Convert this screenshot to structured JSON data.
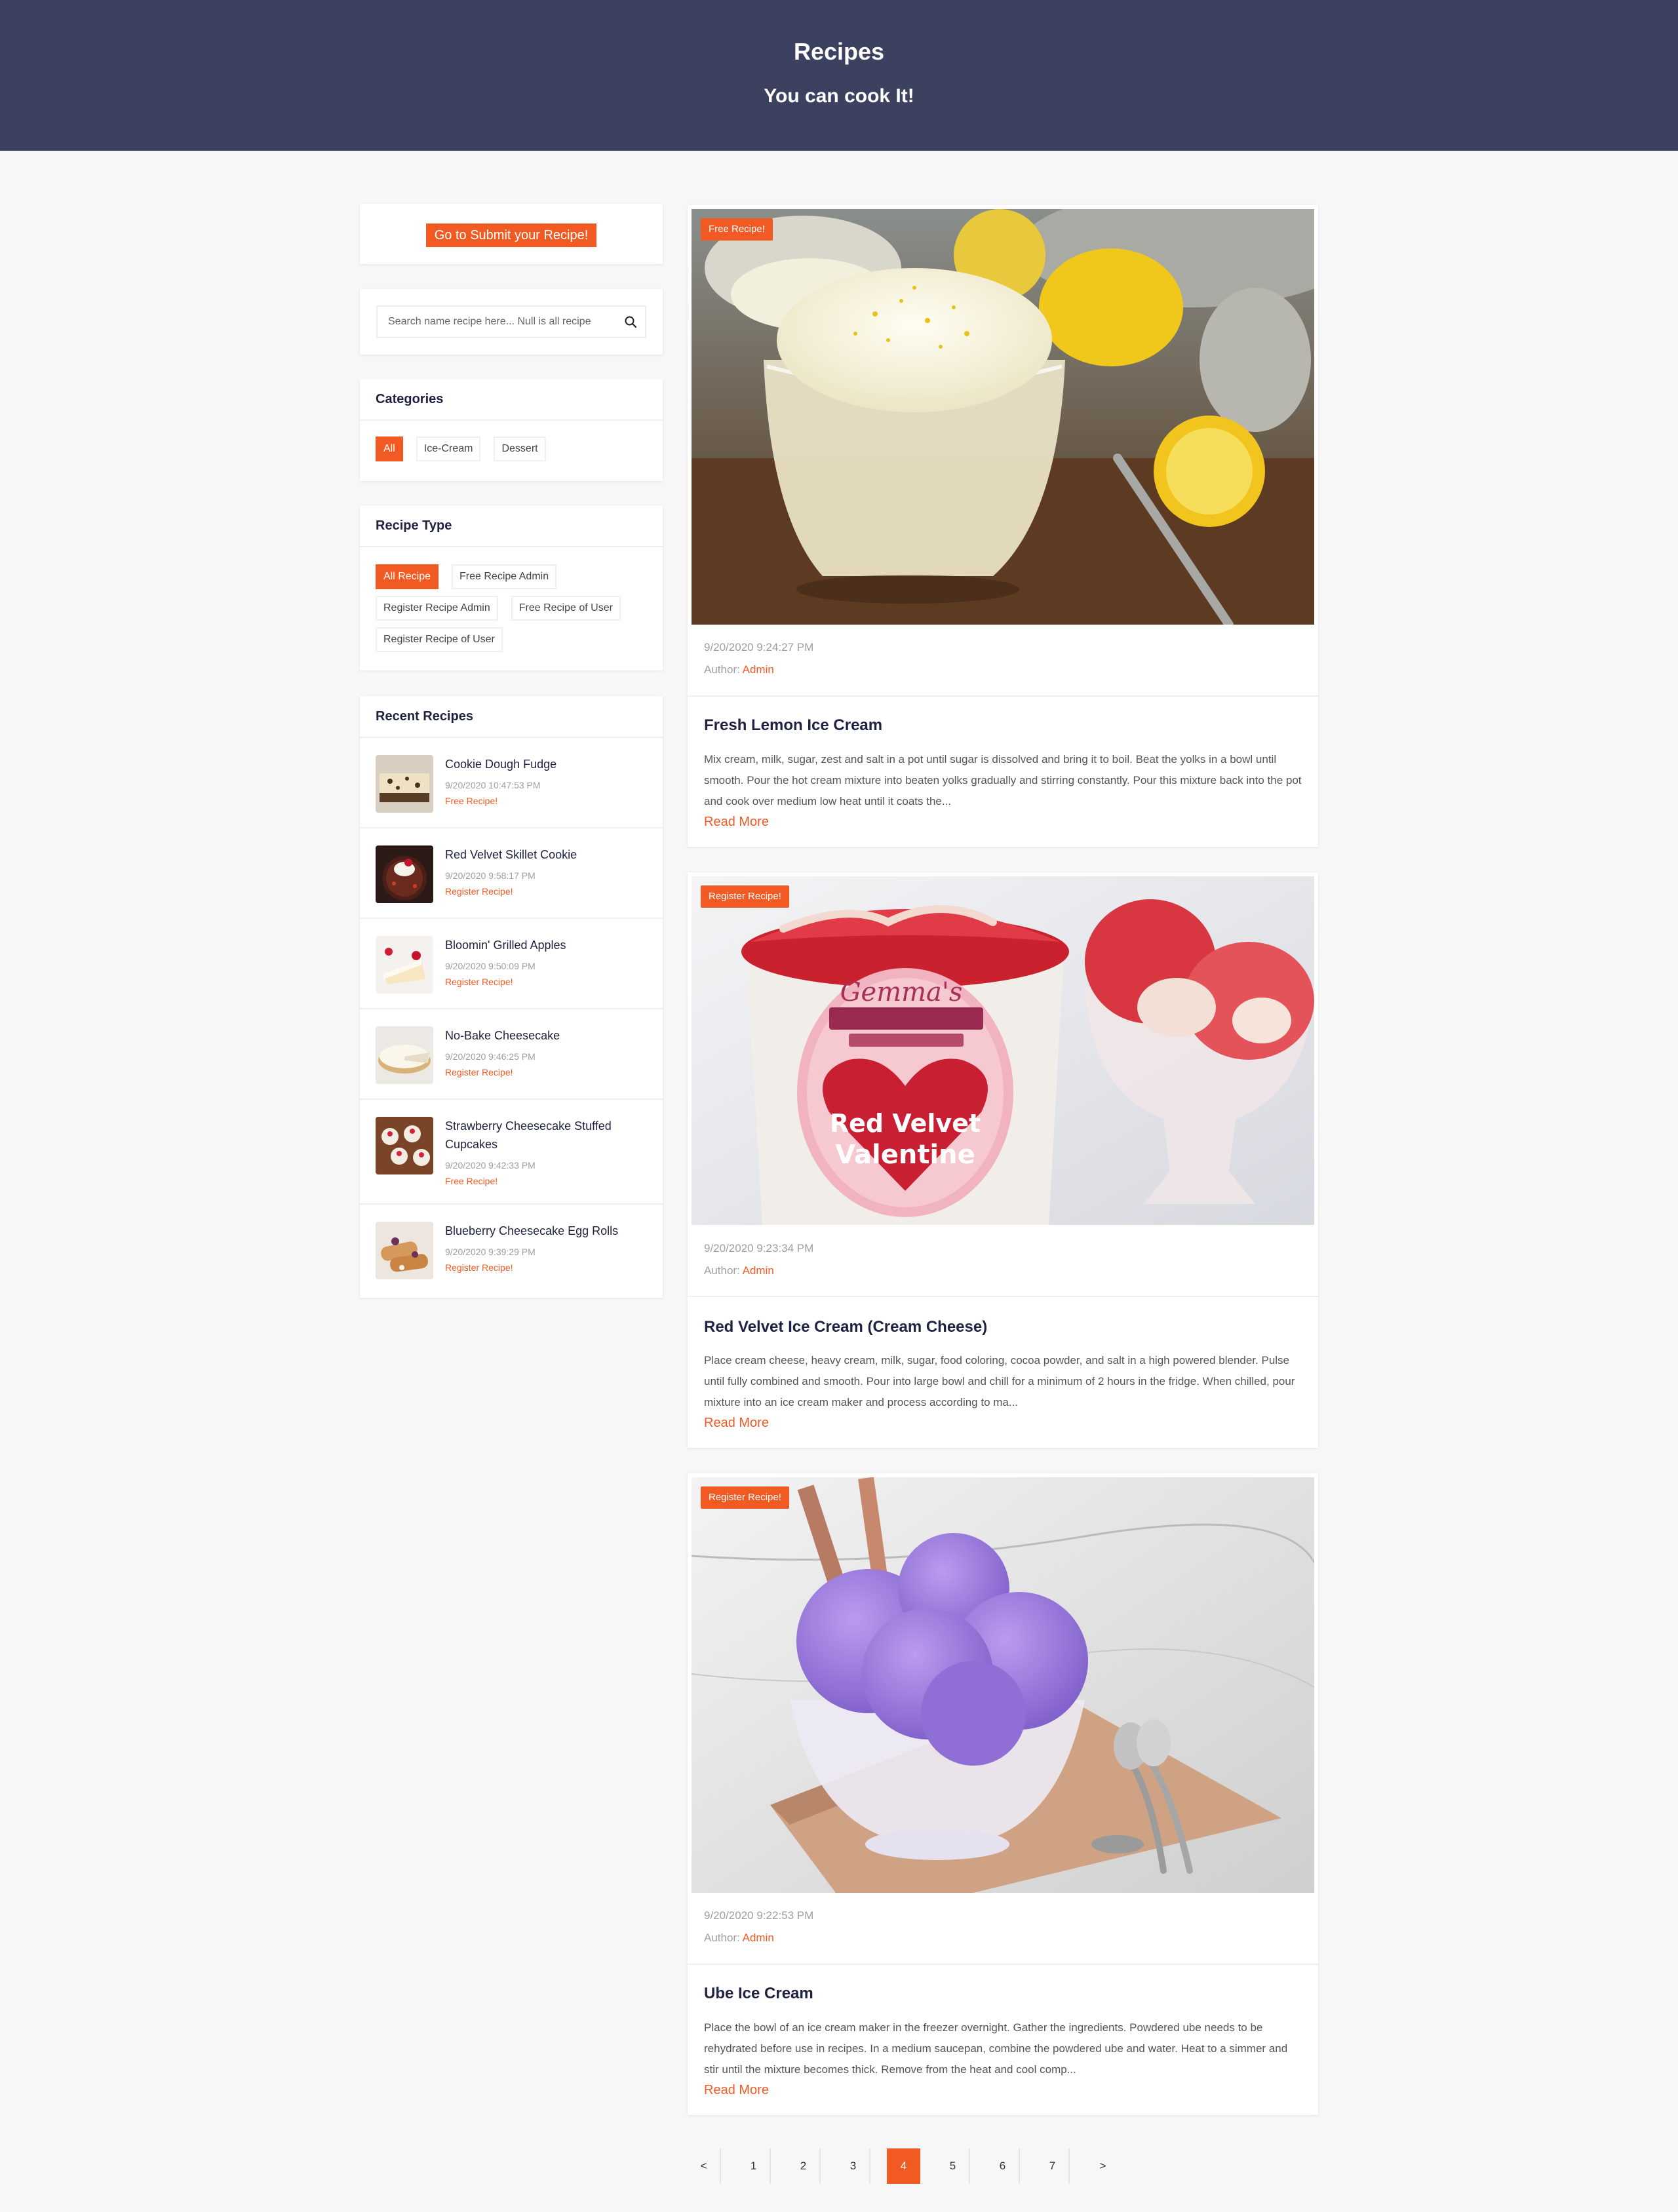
{
  "header": {
    "title": "Recipes",
    "subtitle": "You can cook It!"
  },
  "sidebar": {
    "submit_label": "Go to Submit your Recipe!",
    "search": {
      "placeholder": "Search name recipe here... Null is all recipe"
    },
    "categories": {
      "title": "Categories",
      "items": [
        "All",
        "Ice-Cream",
        "Dessert"
      ],
      "active": "All"
    },
    "recipe_type": {
      "title": "Recipe Type",
      "items": [
        "All Recipe",
        "Free Recipe Admin",
        "Register Recipe Admin",
        "Free Recipe of User",
        "Register Recipe of User"
      ],
      "active": "All Recipe"
    },
    "recent": {
      "title": "Recent Recipes",
      "items": [
        {
          "title": "Cookie Dough Fudge",
          "date": "9/20/2020 10:47:53 PM",
          "type": "Free Recipe!"
        },
        {
          "title": "Red Velvet Skillet Cookie",
          "date": "9/20/2020 9:58:17 PM",
          "type": "Register Recipe!"
        },
        {
          "title": "Bloomin' Grilled Apples",
          "date": "9/20/2020 9:50:09 PM",
          "type": "Register Recipe!"
        },
        {
          "title": "No-Bake Cheesecake",
          "date": "9/20/2020 9:46:25 PM",
          "type": "Register Recipe!"
        },
        {
          "title": "Strawberry Cheesecake Stuffed Cupcakes",
          "date": "9/20/2020 9:42:33 PM",
          "type": "Free Recipe!"
        },
        {
          "title": "Blueberry Cheesecake Egg Rolls",
          "date": "9/20/2020 9:39:29 PM",
          "type": "Register Recipe!"
        }
      ]
    }
  },
  "posts": [
    {
      "badge": "Free Recipe!",
      "date": "9/20/2020 9:24:27 PM",
      "author_label": "Author:",
      "author": "Admin",
      "title": "Fresh Lemon Ice Cream",
      "desc": "Mix cream, milk, sugar, zest and salt in a pot until sugar is dissolved and bring it to boil. Beat the yolks in a bowl until smooth. Pour the hot cream mixture into beaten yolks gradually and stirring constantly. Pour this mixture back into the pot and cook over medium low heat until it coats the...",
      "read_more": "Read More"
    },
    {
      "badge": "Register Recipe!",
      "date": "9/20/2020 9:23:34 PM",
      "author_label": "Author:",
      "author": "Admin",
      "title": "Red Velvet Ice Cream (Cream Cheese)",
      "desc": "Place cream cheese, heavy cream, milk, sugar, food coloring, cocoa powder, and salt in a high powered blender. Pulse until fully combined and smooth. Pour into large bowl and chill for a minimum of 2 hours in the fridge. When chilled, pour mixture into an ice cream maker and process according to ma...",
      "read_more": "Read More",
      "image_text": {
        "brand": "Gemma's",
        "line1": "Red Velvet",
        "line2": "Valentine"
      }
    },
    {
      "badge": "Register Recipe!",
      "date": "9/20/2020 9:22:53 PM",
      "author_label": "Author:",
      "author": "Admin",
      "title": "Ube Ice Cream",
      "desc": "Place the bowl of an ice cream maker in the freezer overnight. Gather the ingredients. Powdered ube needs to be rehydrated before use in recipes. In a medium saucepan, combine the powdered ube and water. Heat to a simmer and stir until the mixture becomes thick. Remove from the heat and cool comp...",
      "read_more": "Read More"
    }
  ],
  "pagination": {
    "prev": "<",
    "pages": [
      "1",
      "2",
      "3",
      "4",
      "5",
      "6",
      "7"
    ],
    "next": ">",
    "current": "4"
  },
  "colors": {
    "accent": "#f25a24",
    "header_bg": "#3d4160",
    "page_bg": "#f7f7f7"
  }
}
